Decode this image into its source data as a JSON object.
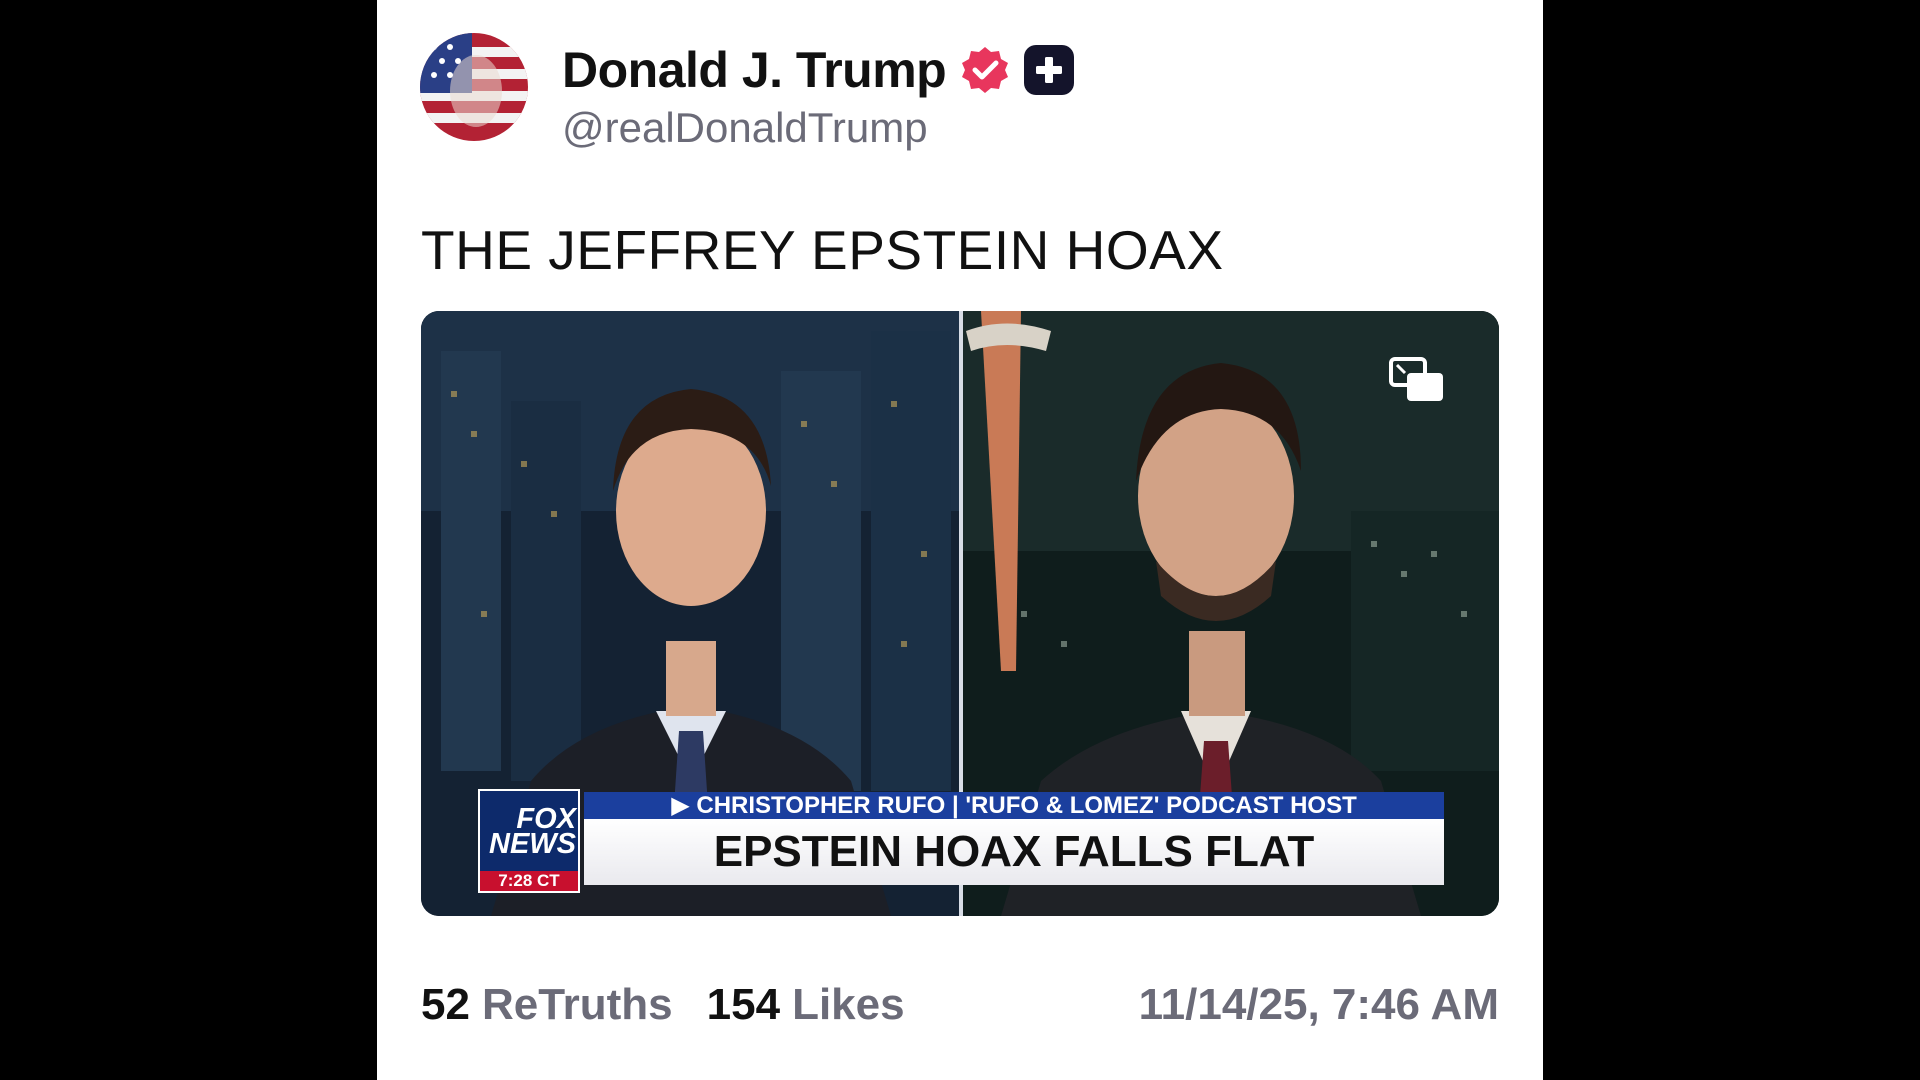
{
  "post": {
    "display_name": "Donald J. Trump",
    "handle": "@realDonaldTrump",
    "text": "THE JEFFREY EPSTEIN HOAX",
    "verified_color": "#e8365d",
    "verified_icon": "verified-badge-icon",
    "plus_icon": "plus-badge-icon"
  },
  "media": {
    "network": "FOX NEWS",
    "network_line1": "FOX",
    "network_line2": "NEWS",
    "time": "7:28 CT",
    "chyron_top": "▶ CHRISTOPHER RUFO | 'RUFO & LOMEZ' PODCAST HOST",
    "chyron_main": "EPSTEIN HOAX FALLS FLAT",
    "pip_icon": "picture-in-picture-icon"
  },
  "stats": {
    "retruths_count": "52",
    "retruths_label": "ReTruths",
    "likes_count": "154",
    "likes_label": "Likes",
    "timestamp": "11/14/25, 7:46 AM"
  }
}
